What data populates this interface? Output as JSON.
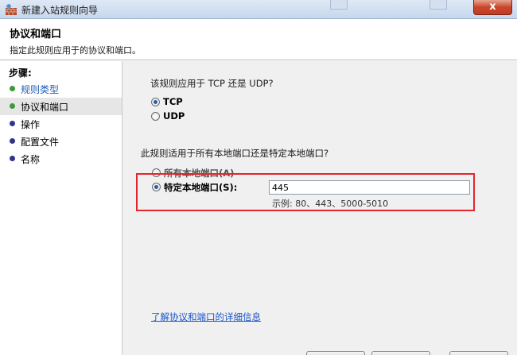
{
  "window": {
    "title": "新建入站规则向导",
    "close_label": "x"
  },
  "header": {
    "title": "协议和端口",
    "description": "指定此规则应用于的协议和端口。"
  },
  "sidebar": {
    "steps_label": "步骤:",
    "items": [
      {
        "label": "规则类型",
        "state": "done"
      },
      {
        "label": "协议和端口",
        "state": "current"
      },
      {
        "label": "操作",
        "state": "todo"
      },
      {
        "label": "配置文件",
        "state": "todo"
      },
      {
        "label": "名称",
        "state": "todo"
      }
    ]
  },
  "protocol": {
    "question": "该规则应用于 TCP 还是 UDP?",
    "options": [
      {
        "label": "TCP",
        "selected": true
      },
      {
        "label": "UDP",
        "selected": false
      }
    ]
  },
  "ports": {
    "question": "此规则适用于所有本地端口还是特定本地端口?",
    "all_label": "所有本地端口(A)",
    "specific_label": "特定本地端口(S):",
    "selected": "specific",
    "value": "445",
    "example": "示例: 80、443、5000-5010"
  },
  "link": {
    "label": "了解协议和端口的详细信息"
  },
  "colors": {
    "highlight": "#e3252d",
    "link": "#1a55c8",
    "step_done": "#3b9a3b",
    "step_todo": "#33338f"
  }
}
